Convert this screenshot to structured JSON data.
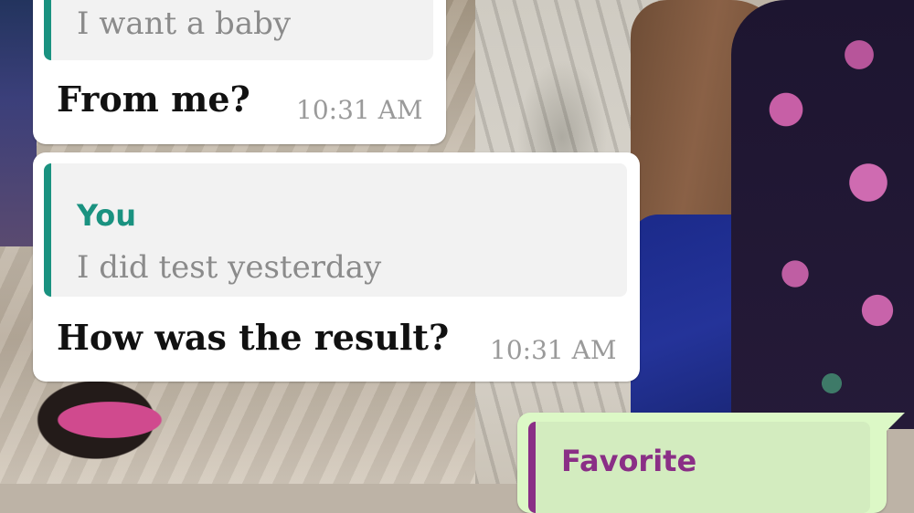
{
  "colors": {
    "incoming_bubble": "#ffffff",
    "outgoing_bubble": "#dcf8c6",
    "quote_background": "#f2f2f2",
    "quote_bar_you": "#1a9280",
    "quote_bar_favorite": "#8a2f86",
    "sender_you": "#1a9280",
    "sender_favorite": "#8a2f86",
    "timestamp": "#9a9a9a"
  },
  "messages": [
    {
      "direction": "incoming",
      "quote": {
        "sender": "",
        "text": "I want a baby"
      },
      "text": "From me?",
      "time": "10:31 AM"
    },
    {
      "direction": "incoming",
      "quote": {
        "sender": "You",
        "text": "I did test yesterday"
      },
      "text": "How was the result?",
      "time": "10:31 AM"
    },
    {
      "direction": "outgoing",
      "quote": {
        "sender": "Favorite",
        "text": ""
      },
      "text": "",
      "time": ""
    }
  ]
}
